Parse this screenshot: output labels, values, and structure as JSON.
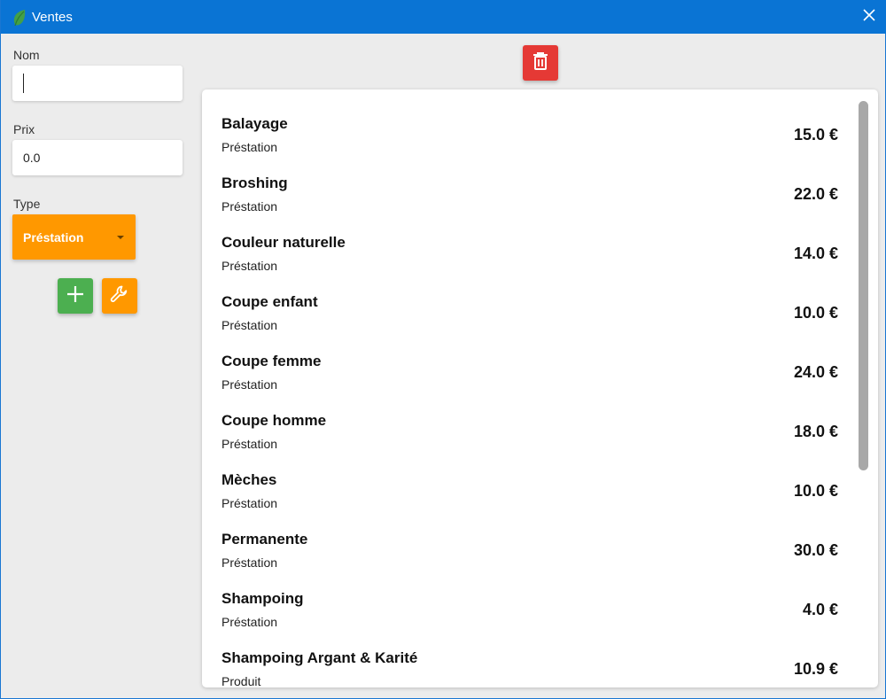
{
  "window": {
    "title": "Ventes",
    "accent_color": "#0a74d4",
    "app_icon": "leaf-icon",
    "close_icon": "close-icon"
  },
  "form": {
    "nom_label": "Nom",
    "nom_value": "",
    "prix_label": "Prix",
    "prix_value": "0.0",
    "type_label": "Type",
    "type_value": "Préstation",
    "type_color": "#ff9800",
    "add_icon": "plus-icon",
    "add_color": "#4caf50",
    "edit_icon": "wrench-icon",
    "edit_color": "#ff9800"
  },
  "toolbar": {
    "delete_icon": "trash-icon",
    "delete_color": "#e53935"
  },
  "items": [
    {
      "name": "Balayage",
      "type": "Préstation",
      "price": "15.0 €"
    },
    {
      "name": "Broshing",
      "type": "Préstation",
      "price": "22.0 €"
    },
    {
      "name": "Couleur naturelle",
      "type": "Préstation",
      "price": "14.0 €"
    },
    {
      "name": "Coupe enfant",
      "type": "Préstation",
      "price": "10.0 €"
    },
    {
      "name": "Coupe femme",
      "type": "Préstation",
      "price": "24.0 €"
    },
    {
      "name": "Coupe homme",
      "type": "Préstation",
      "price": "18.0 €"
    },
    {
      "name": "Mèches",
      "type": "Préstation",
      "price": "10.0 €"
    },
    {
      "name": "Permanente",
      "type": "Préstation",
      "price": "30.0 €"
    },
    {
      "name": "Shampoing",
      "type": "Préstation",
      "price": "4.0 €"
    },
    {
      "name": "Shampoing Argant & Karité",
      "type": "Produit",
      "price": "10.9 €"
    }
  ]
}
